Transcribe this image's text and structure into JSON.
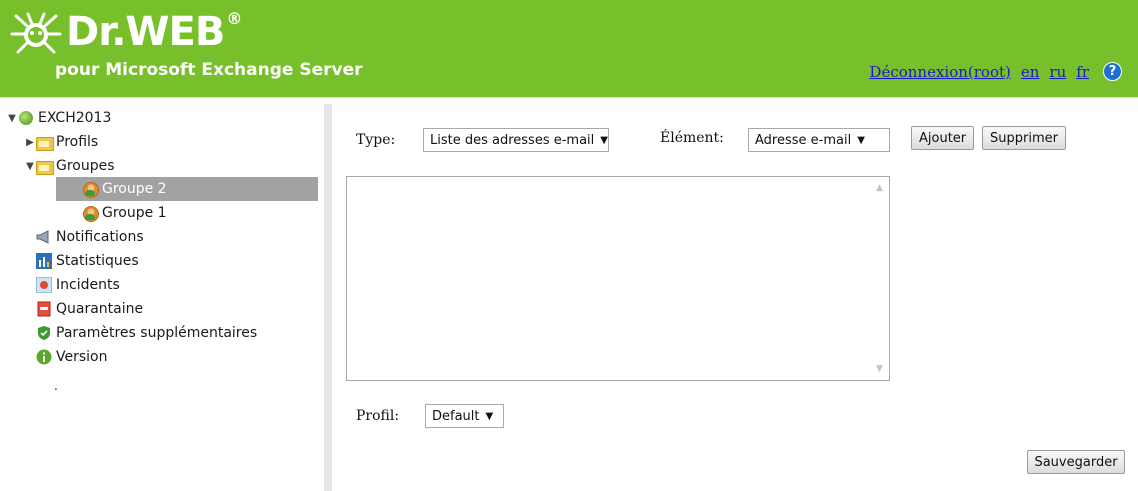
{
  "header": {
    "logo_text": "Dr.WEB",
    "logo_reg": "®",
    "subtitle": "pour Microsoft Exchange Server",
    "logout_link": "Déconnexion(root)",
    "lang_en": "en",
    "lang_ru": "ru",
    "lang_fr": "fr",
    "help_icon_glyph": "?",
    "brand_color": "#77c02b"
  },
  "tree": {
    "root": "EXCH2013",
    "profils": "Profils",
    "groupes": "Groupes",
    "groupe2": "Groupe 2",
    "groupe1": "Groupe 1",
    "notifications": "Notifications",
    "statistiques": "Statistiques",
    "incidents": "Incidents",
    "quarantaine": "Quarantaine",
    "parametres": "Paramètres supplémentaires",
    "version": "Version",
    "dot": "."
  },
  "form": {
    "type_label": "Type:",
    "type_value": "Liste des adresses e-mail",
    "element_label": "Élément:",
    "element_value": "Adresse e-mail",
    "add_button": "Ajouter",
    "delete_button": "Supprimer",
    "profil_label": "Profil:",
    "profil_value": "Default",
    "save_button": "Sauvegarder"
  }
}
